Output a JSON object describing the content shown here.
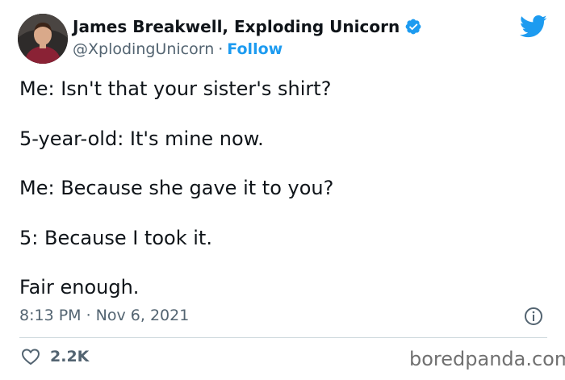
{
  "author": {
    "name": "James Breakwell, Exploding Unicorn",
    "handle": "@XplodingUnicorn",
    "separator": "·",
    "follow_label": "Follow"
  },
  "tweet": {
    "lines": [
      "Me: Isn't that your sister's shirt?",
      "5-year-old: It's mine now.",
      "Me: Because she gave it to you?",
      "5: Because I took it.",
      "Fair enough."
    ],
    "timestamp": "8:13 PM · Nov 6, 2021"
  },
  "engagement": {
    "likes": "2.2K"
  },
  "watermark": "boredpanda.com",
  "colors": {
    "accent": "#1d9bf0",
    "text": "#0f1419",
    "secondary": "#536471",
    "divider": "#cfd9de"
  },
  "icons": {
    "verified": "verified-badge-icon",
    "logo": "twitter-bird-icon",
    "info": "info-icon",
    "like": "heart-icon"
  }
}
